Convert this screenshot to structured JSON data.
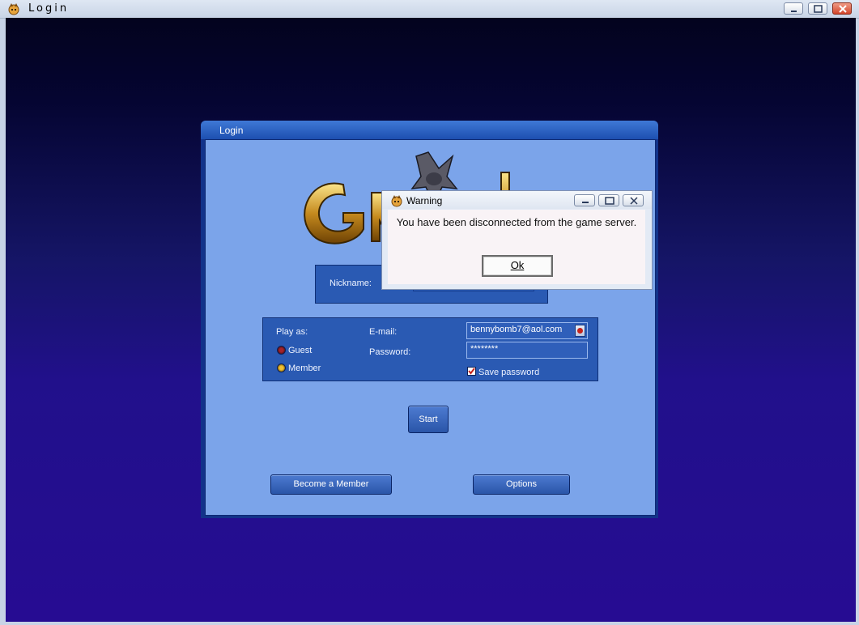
{
  "outer_window": {
    "title": "Login"
  },
  "login_dialog": {
    "title": "Login",
    "nickname_label": "Nickname:",
    "play_as_label": "Play as:",
    "guest_label": "Guest",
    "member_label": "Member",
    "email_label": "E-mail:",
    "email_value": "bennybomb7@aol.com",
    "password_label": "Password:",
    "password_value": "********",
    "save_password_label": "Save password",
    "start_button": "Start",
    "become_member_button": "Become a Member",
    "options_button": "Options"
  },
  "warning_dialog": {
    "title": "Warning",
    "message": "You have been disconnected from the game server.",
    "ok_button": "Ok"
  },
  "colors": {
    "dialog_body": "#7ba4ea",
    "panel": "#2a5ab3",
    "background_top": "#03031e",
    "background_bottom": "#260c92"
  }
}
